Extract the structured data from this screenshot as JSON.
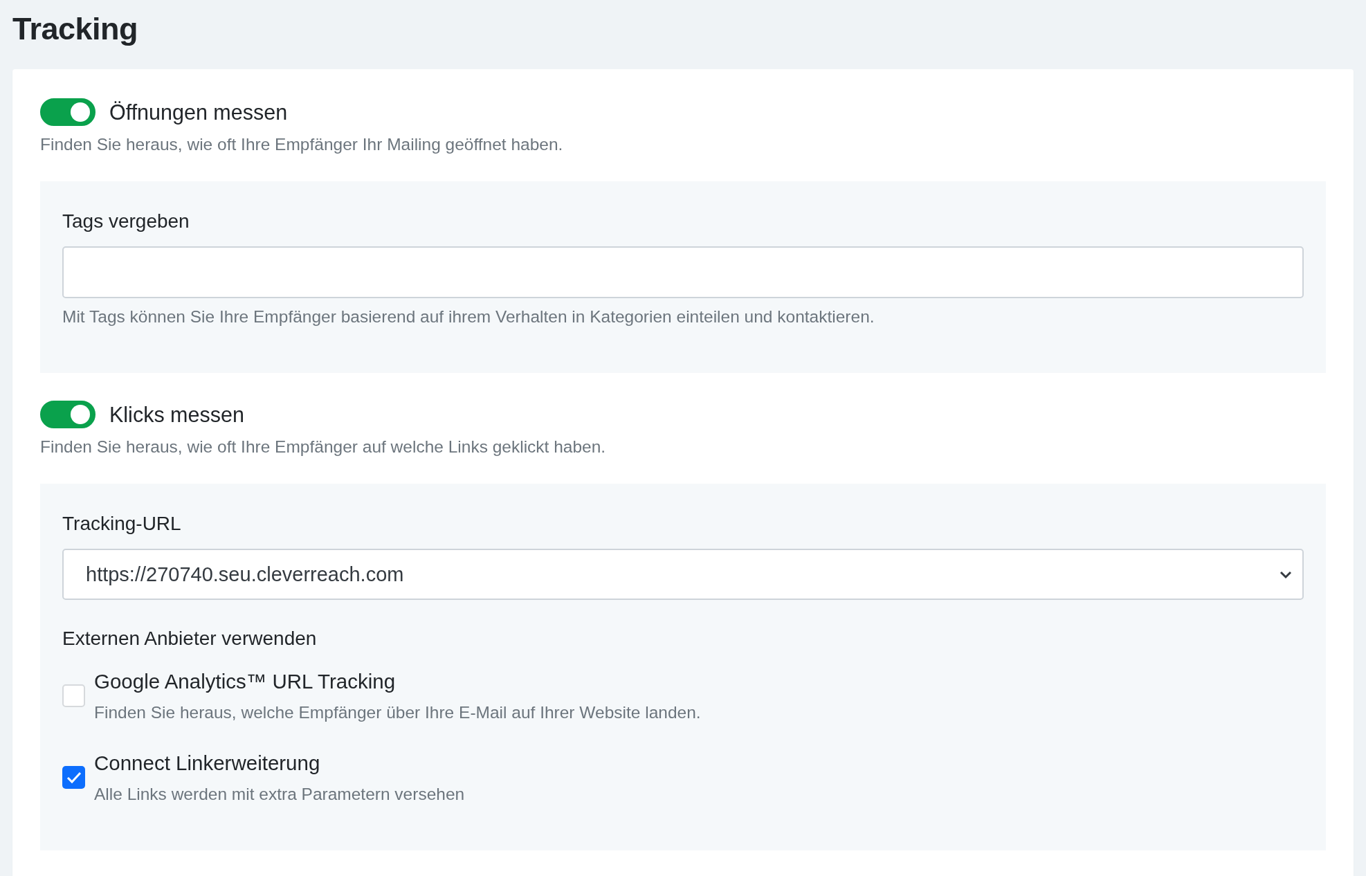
{
  "title": "Tracking",
  "sections": [
    {
      "toggle": {
        "label": "Öffnungen messen",
        "on": true
      },
      "description": "Finden Sie heraus, wie oft Ihre Empfänger Ihr Mailing geöffnet haben.",
      "panel": {
        "kind": "tags",
        "label": "Tags vergeben",
        "help": "Mit Tags können Sie Ihre Empfänger basierend auf ihrem Verhalten in Kategorien einteilen und kontaktieren."
      }
    },
    {
      "toggle": {
        "label": "Klicks messen",
        "on": true
      },
      "description": "Finden Sie heraus, wie oft Ihre Empfänger auf welche Links geklickt haben.",
      "panel": {
        "kind": "url",
        "label": "Tracking-URL",
        "value": "https://270740.seu.cleverreach.com",
        "group_label": "Externen Anbieter verwenden",
        "options": [
          {
            "label": "Google Analytics™ URL Tracking",
            "description": "Finden Sie heraus, welche Empfänger über Ihre E-Mail auf Ihrer Website landen.",
            "checked": false
          },
          {
            "label": "Connect Linkerweiterung",
            "description": "Alle Links werden mit extra Parametern versehen",
            "checked": true
          }
        ]
      }
    }
  ]
}
